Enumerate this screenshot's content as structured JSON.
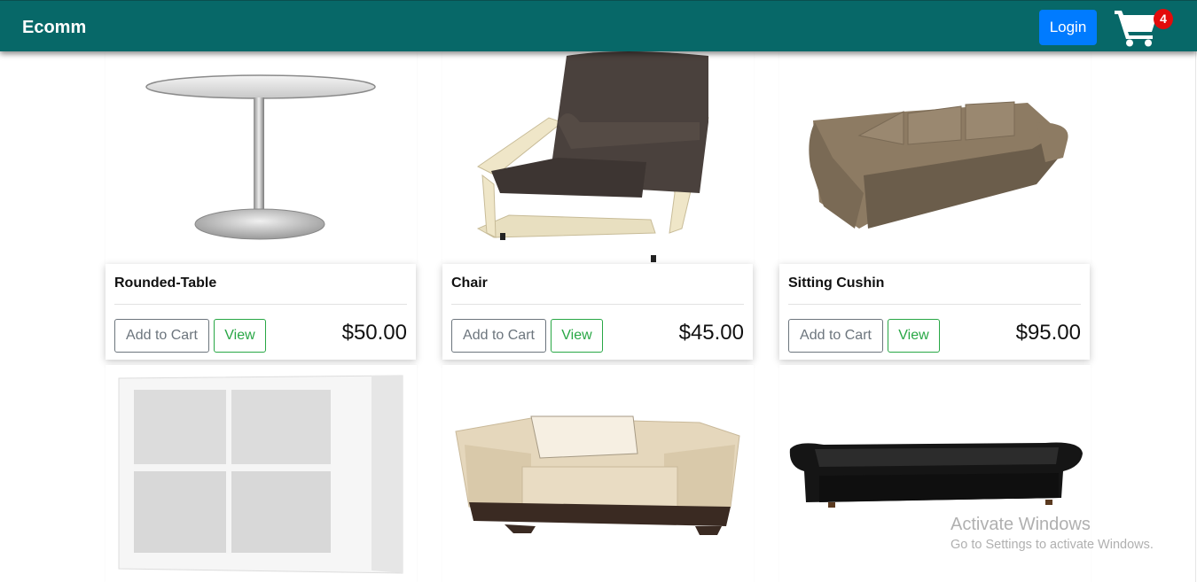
{
  "navbar": {
    "brand": "Ecomm",
    "login_label": "Login",
    "cart_count": "4",
    "colors": {
      "background": "#076868",
      "login": "#007bff",
      "badge": "#e30b0b"
    }
  },
  "products": [
    {
      "name": "Rounded-Table",
      "price": "$50.00",
      "add_label": "Add to Cart",
      "view_label": "View",
      "image": "round-table-image"
    },
    {
      "name": "Chair",
      "price": "$45.00",
      "add_label": "Add to Cart",
      "view_label": "View",
      "image": "lounge-chair-image"
    },
    {
      "name": "Sitting Cushin",
      "price": "$95.00",
      "add_label": "Add to Cart",
      "view_label": "View",
      "image": "sofa-image"
    },
    {
      "image": "shelf-image"
    },
    {
      "image": "armchair-image"
    },
    {
      "image": "leather-sofa-image"
    }
  ],
  "watermark": {
    "title": "Activate Windows",
    "subtitle": "Go to Settings to activate Windows."
  }
}
